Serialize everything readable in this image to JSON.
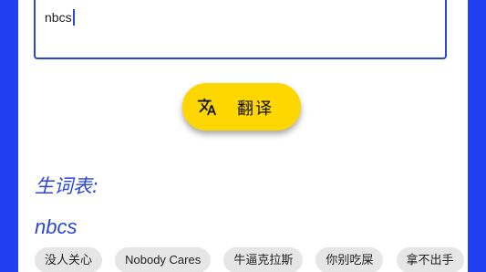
{
  "input": {
    "value": "nbcs"
  },
  "translate_button": {
    "label": "翻译",
    "icon": "translate-icon"
  },
  "vocab": {
    "title": "生词表:",
    "word": "nbcs",
    "chips": [
      "没人关心",
      "Nobody Cares",
      "牛逼克拉斯",
      "你别吃屎",
      "拿不出手"
    ]
  },
  "colors": {
    "frame": "#1f3ff0",
    "accent": "#2a46d6",
    "button": "#ffd700",
    "chip_bg": "#e6e6e6"
  }
}
